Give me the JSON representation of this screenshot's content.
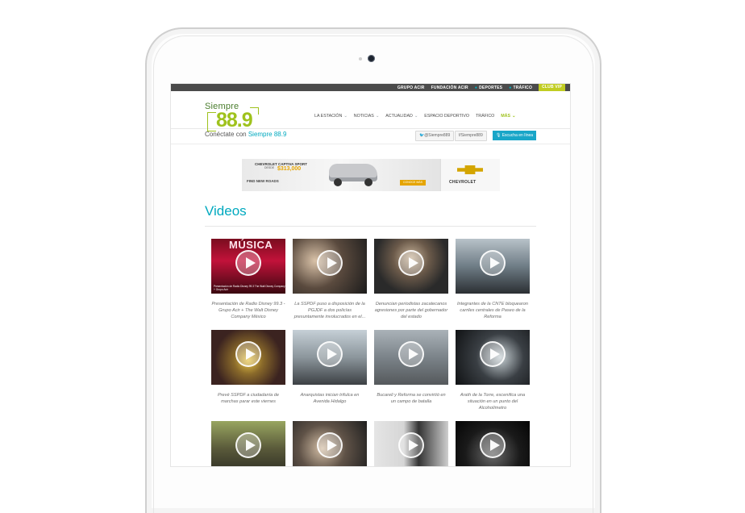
{
  "topnav": {
    "items": [
      "GRUPO ACIR",
      "FUNDACIÓN ACIR",
      "DEPORTES",
      "TRÁFICO"
    ],
    "vip": "CLUB VIP"
  },
  "logo": {
    "line1": "Siempre",
    "line2": "88.9"
  },
  "nav": {
    "items": [
      "LA ESTACIÓN",
      "NOTICIAS",
      "ACTUALIDAD",
      "ESPACIO DEPORTIVO",
      "TRÁFICO"
    ],
    "more": "MÁS"
  },
  "connect": {
    "prefix": "Conéctate con",
    "brand": "Siempre 88.9"
  },
  "social": {
    "twitter": "@Siempre889",
    "facebook": "/Siempre889",
    "live": "Escucha en línea"
  },
  "ad": {
    "model": "CHEVROLET CAPTIVA SPORT",
    "from": "DESDE",
    "price": "$313,000",
    "slogan": "FIND NEW ROADS",
    "cta": "CONOCE MÁS",
    "brand": "CHEVROLET",
    "colors": {
      "gold": "#e5a400"
    }
  },
  "page": {
    "title": "Videos"
  },
  "videos": [
    {
      "caption": "Presentación de Radio Disney 99.3 - Grupo Acir + The Walt Disney Company México",
      "overlay": "Presentación de Radio Disney 99.3 The Walt Disney Company + Grupo Acir",
      "bannerText": "MÚSICA"
    },
    {
      "caption": "La SSPDF puso a disposición de la PGJDF a dos policías presuntamente involucrados en el..."
    },
    {
      "caption": "Denuncian periodistas zacatecanos agresiones por parte del gobernador del estado"
    },
    {
      "caption": "Integrantes de la CNTE bloquearon carriles centrales de Paseo de la Reforma"
    },
    {
      "caption": "Prevé SSPDF a ciudadanía de marchas parar este viernes"
    },
    {
      "caption": "Anarquistas inician trifulca en Avenida Hidalgo"
    },
    {
      "caption": "Bucareli y Reforma se convirtió en un campo de batalla"
    },
    {
      "caption": "Arath de la Torre, escenifica una situación en un punto del Alcoholímetro"
    },
    {
      "caption": ""
    },
    {
      "caption": ""
    },
    {
      "caption": ""
    },
    {
      "caption": ""
    }
  ],
  "colors": {
    "accent": "#00a9bf",
    "lime": "#9fc21d",
    "topbar": "#4b4b4b"
  }
}
